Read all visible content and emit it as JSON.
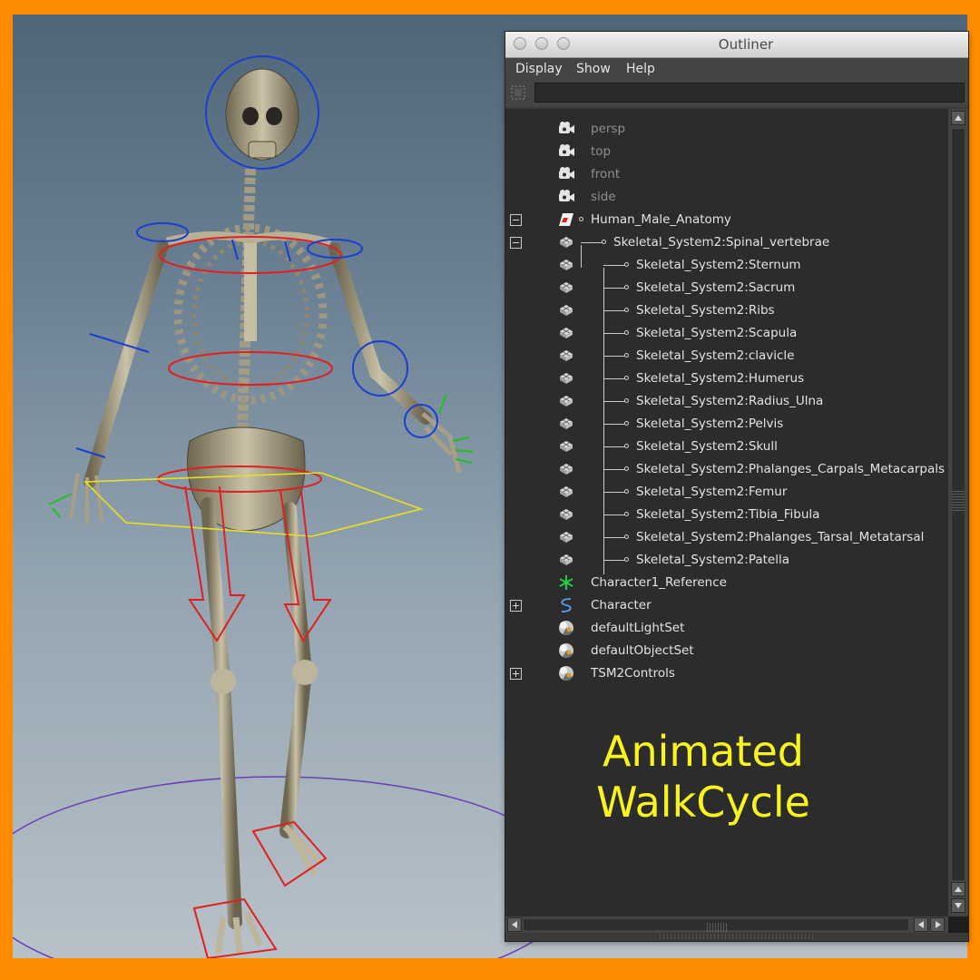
{
  "window": {
    "title": "Outliner",
    "menu": [
      "Display",
      "Show",
      "Help"
    ],
    "filter_value": ""
  },
  "tree": [
    {
      "label": "persp",
      "icon": "camera-icon",
      "dim": true
    },
    {
      "label": "top",
      "icon": "camera-icon",
      "dim": true
    },
    {
      "label": "front",
      "icon": "camera-icon",
      "dim": true
    },
    {
      "label": "side",
      "icon": "camera-icon",
      "dim": true
    },
    {
      "label": "Human_Male_Anatomy",
      "icon": "group-transform-icon",
      "expander": "minus"
    },
    {
      "label": "Skeletal_System2:Spinal_vertebrae",
      "icon": "mesh-icon",
      "expander": "minus"
    },
    {
      "label": "Skeletal_System2:Sternum",
      "icon": "mesh-icon"
    },
    {
      "label": "Skeletal_System2:Sacrum",
      "icon": "mesh-icon"
    },
    {
      "label": "Skeletal_System2:Ribs",
      "icon": "mesh-icon"
    },
    {
      "label": "Skeletal_System2:Scapula",
      "icon": "mesh-icon"
    },
    {
      "label": "Skeletal_System2:clavicle",
      "icon": "mesh-icon"
    },
    {
      "label": "Skeletal_System2:Humerus",
      "icon": "mesh-icon"
    },
    {
      "label": "Skeletal_System2:Radius_Ulna",
      "icon": "mesh-icon"
    },
    {
      "label": "Skeletal_System2:Pelvis",
      "icon": "mesh-icon"
    },
    {
      "label": "Skeletal_System2:Skull",
      "icon": "mesh-icon"
    },
    {
      "label": "Skeletal_System2:Phalanges_Carpals_Metacarpals",
      "icon": "mesh-icon"
    },
    {
      "label": "Skeletal_System2:Femur",
      "icon": "mesh-icon"
    },
    {
      "label": "Skeletal_System2:Tibia_Fibula",
      "icon": "mesh-icon"
    },
    {
      "label": "Skeletal_System2:Phalanges_Tarsal_Metatarsal",
      "icon": "mesh-icon"
    },
    {
      "label": "Skeletal_System2:Patella",
      "icon": "mesh-icon"
    },
    {
      "label": "Character1_Reference",
      "icon": "joint-icon"
    },
    {
      "label": "Character",
      "icon": "curve-icon",
      "expander": "plus"
    },
    {
      "label": "defaultLightSet",
      "icon": "set-icon"
    },
    {
      "label": "defaultObjectSet",
      "icon": "set-icon"
    },
    {
      "label": "TSM2Controls",
      "icon": "set-icon",
      "expander": "plus"
    }
  ],
  "caption": [
    "Animated",
    "WalkCycle"
  ],
  "colors": {
    "frame": "#ff8c00",
    "caption": "#f7f420",
    "outliner_bg": "#2c2c2c",
    "control_red": "#e02020",
    "control_blue": "#1a3fd0",
    "control_yellow": "#e8e020"
  }
}
